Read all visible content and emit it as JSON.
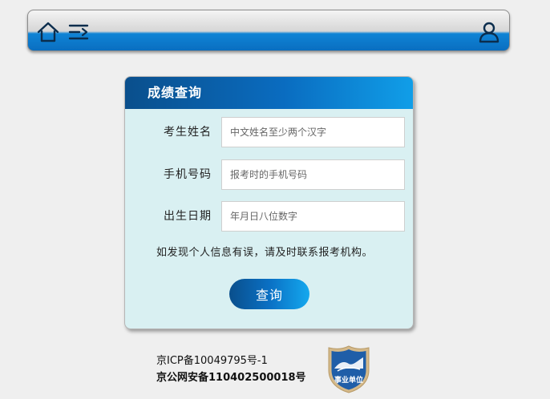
{
  "nav": {
    "home_icon": "home-icon",
    "menu_icon": "menu-icon",
    "user_icon": "user-icon"
  },
  "card": {
    "title": "成绩查询",
    "fields": [
      {
        "label": "考生姓名",
        "placeholder": "中文姓名至少两个汉字",
        "value": ""
      },
      {
        "label": "手机号码",
        "placeholder": "报考时的手机号码",
        "value": ""
      },
      {
        "label": "出生日期",
        "placeholder": "年月日八位数字",
        "value": ""
      }
    ],
    "notice": "如发现个人信息有误，请及时联系报考机构。",
    "query_label": "查询"
  },
  "footer": {
    "icp": "京ICP备10049795号-1",
    "police": "京公网安备110402500018号",
    "badge_label": "事业单位"
  },
  "colors": {
    "accent_dark": "#0a4f8c",
    "accent_light": "#14a8ee",
    "card_bg": "#d9f0f2",
    "page_bg": "#efefef"
  }
}
